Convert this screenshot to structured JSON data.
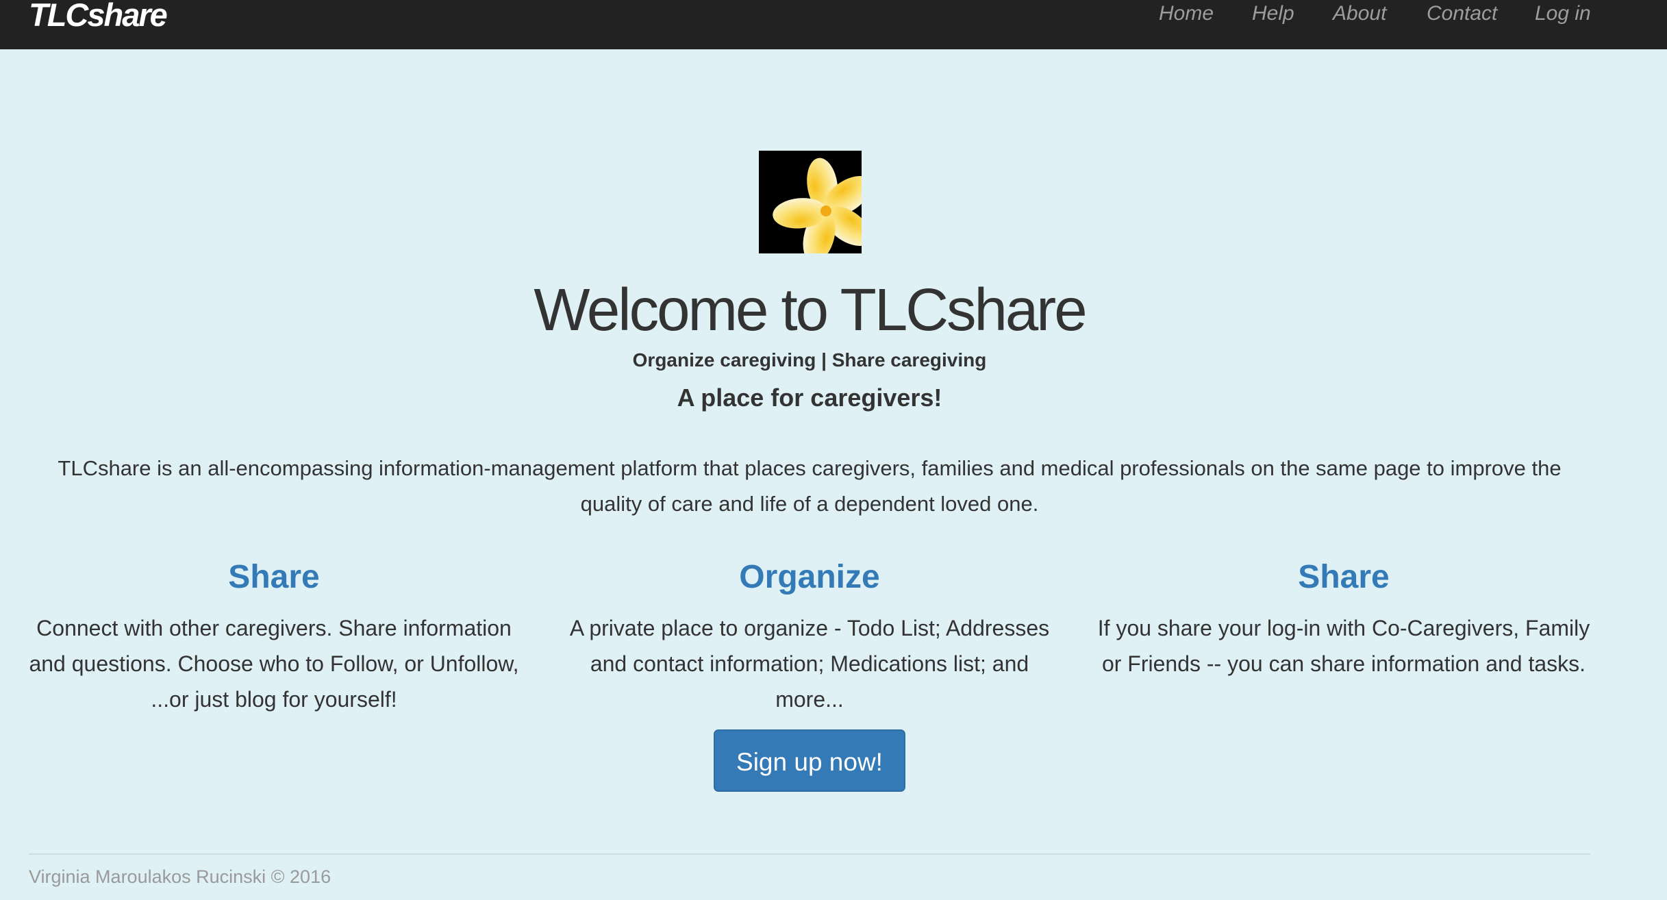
{
  "navbar": {
    "brand": "TLCshare",
    "links": [
      {
        "label": "Home"
      },
      {
        "label": "Help"
      },
      {
        "label": "About"
      },
      {
        "label": "Contact"
      },
      {
        "label": "Log in"
      }
    ]
  },
  "hero": {
    "logo_icon": "plumeria-flower-icon",
    "title": "Welcome to TLCshare",
    "tagline": "Organize caregiving | Share caregiving",
    "subtitle": "A place for caregivers!",
    "intro": "TLCshare is an all-encompassing information-management platform that places caregivers, families and medical professionals on the same page to improve the quality of care and life of a dependent loved one."
  },
  "features": [
    {
      "heading": "Share",
      "text": "Connect with other caregivers. Share information and questions. Choose who to Follow, or Unfollow, ...or just blog for yourself!"
    },
    {
      "heading": "Organize",
      "text": "A private place to organize - Todo List; Addresses and contact information; Medications list; and more..."
    },
    {
      "heading": "Share",
      "text": "If you share your log-in with Co-Caregivers, Family or Friends -- you can share information and tasks."
    }
  ],
  "cta": {
    "label": "Sign up now!"
  },
  "footer": {
    "text": "Virginia Maroulakos Rucinski © 2016"
  },
  "colors": {
    "navbar": "#222222",
    "background": "#dff1f5",
    "accent": "#337ab7"
  }
}
